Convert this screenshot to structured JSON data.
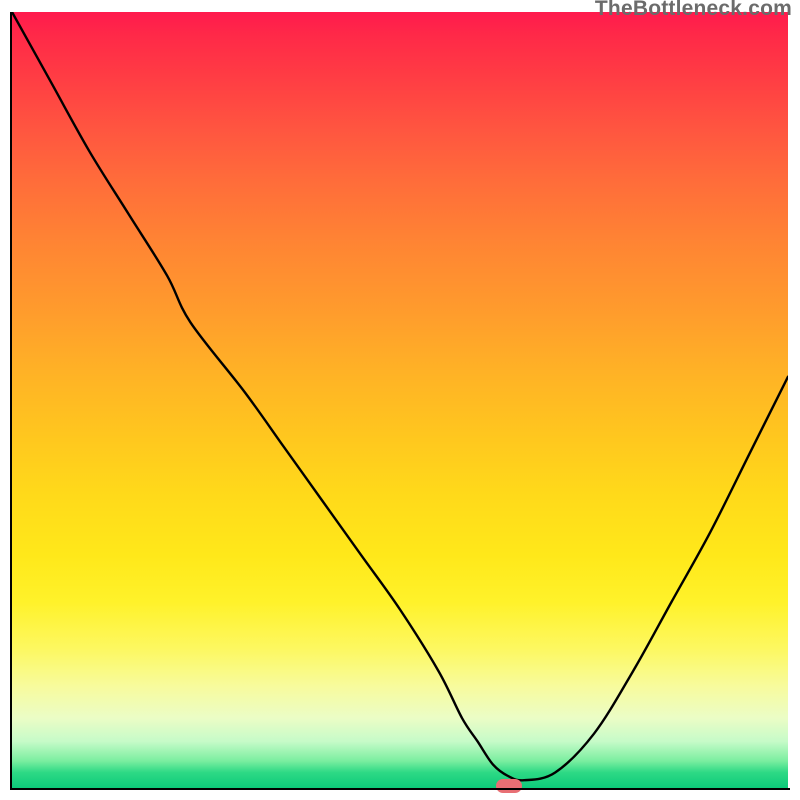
{
  "watermark": "TheBottleneck.com",
  "colors": {
    "gradient_top": "#ff1a4d",
    "gradient_mid": "#ffd91a",
    "gradient_bottom": "#0dca7a",
    "line": "#000000",
    "marker": "#e86f74",
    "axis": "#000000"
  },
  "chart_data": {
    "type": "line",
    "title": "",
    "xlabel": "",
    "ylabel": "",
    "xlim": [
      0,
      100
    ],
    "ylim": [
      0,
      100
    ],
    "x": [
      0,
      5,
      10,
      15,
      20,
      23,
      30,
      35,
      40,
      45,
      50,
      55,
      58,
      60,
      62,
      64,
      66,
      70,
      75,
      80,
      85,
      90,
      95,
      100
    ],
    "values": [
      100,
      91,
      82,
      74,
      66,
      60,
      51,
      44,
      37,
      30,
      23,
      15,
      9,
      6,
      3,
      1.5,
      1,
      2,
      7,
      15,
      24,
      33,
      43,
      53
    ],
    "series": [
      {
        "name": "bottleneck-curve",
        "x": [
          0,
          5,
          10,
          15,
          20,
          23,
          30,
          35,
          40,
          45,
          50,
          55,
          58,
          60,
          62,
          64,
          66,
          70,
          75,
          80,
          85,
          90,
          95,
          100
        ],
        "values": [
          100,
          91,
          82,
          74,
          66,
          60,
          51,
          44,
          37,
          30,
          23,
          15,
          9,
          6,
          3,
          1.5,
          1,
          2,
          7,
          15,
          24,
          33,
          43,
          53
        ]
      }
    ],
    "marker": {
      "x": 64,
      "y": 0
    },
    "annotations": []
  }
}
